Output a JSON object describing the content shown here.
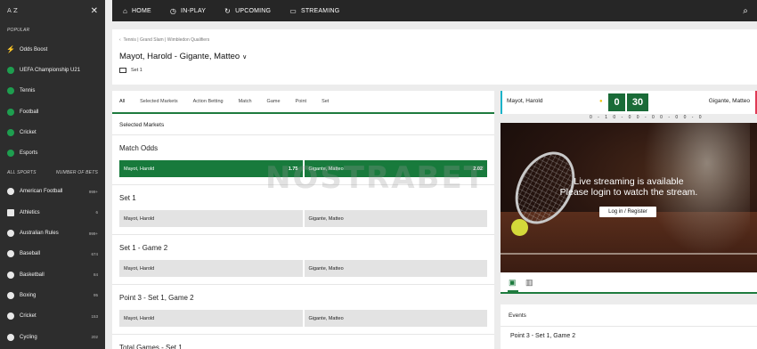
{
  "sidebar": {
    "az": "A Z",
    "popular_heading": "POPULAR",
    "popular": [
      {
        "label": "Odds Boost",
        "icon": "odds-boost-icon"
      },
      {
        "label": "UEFA Championship U21",
        "icon": "football-icon"
      },
      {
        "label": "Tennis",
        "icon": "tennis-icon"
      },
      {
        "label": "Football",
        "icon": "football-icon"
      },
      {
        "label": "Cricket",
        "icon": "cricket-icon"
      },
      {
        "label": "Esports",
        "icon": "esports-icon"
      }
    ],
    "all_sports_heading": "ALL SPORTS",
    "number_of_bets_heading": "NUMBER OF BETS",
    "sports": [
      {
        "label": "American Football",
        "count": "999+"
      },
      {
        "label": "Athletics",
        "count": "6"
      },
      {
        "label": "Australian Rules",
        "count": "999+"
      },
      {
        "label": "Baseball",
        "count": "674"
      },
      {
        "label": "Basketball",
        "count": "84"
      },
      {
        "label": "Boxing",
        "count": "95"
      },
      {
        "label": "Cricket",
        "count": "153"
      },
      {
        "label": "Cycling",
        "count": "202"
      }
    ]
  },
  "topnav": {
    "home": "HOME",
    "inplay": "IN-PLAY",
    "upcoming": "UPCOMING",
    "streaming": "STREAMING"
  },
  "header": {
    "breadcrumb": "Tennis | Grand Slam | Wimbledon Qualifiers",
    "title": "Mayot, Harold - Gigante, Matteo",
    "set_indicator": "Set 1"
  },
  "markets": {
    "tabs": [
      "All",
      "Selected Markets",
      "Action Betting",
      "Match",
      "Game",
      "Point",
      "Set"
    ],
    "section_title": "Selected Markets",
    "list": [
      {
        "name": "Match Odds",
        "home": "Mayot, Harold",
        "home_price": "1.75",
        "away": "Gigante, Matteo",
        "away_price": "2.02"
      },
      {
        "name": "Set 1",
        "home": "Mayot, Harold",
        "away": "Gigante, Matteo"
      },
      {
        "name": "Set 1 - Game 2",
        "home": "Mayot, Harold",
        "away": "Gigante, Matteo"
      },
      {
        "name": "Point 3 - Set 1, Game 2",
        "home": "Mayot, Harold",
        "away": "Gigante, Matteo"
      },
      {
        "name": "Total Games - Set 1"
      }
    ]
  },
  "watermark": "NOSTRABET",
  "scoreboard": {
    "player1": "Mayot, Harold",
    "player2": "Gigante, Matteo",
    "games": "0",
    "points": "30",
    "set_scores": "0 - 1   0 - 0   0 - 0   0 - 0   0 - 0"
  },
  "stream": {
    "line1": "Live streaming is available",
    "line2": "Please login to watch the stream.",
    "login": "Log in / Register"
  },
  "events": {
    "title": "Events",
    "item": "Point 3 - Set 1, Game 2"
  },
  "colors": {
    "accent": "#1e7b3e",
    "sidebar": "#2d2d2d",
    "nav": "#262626"
  }
}
